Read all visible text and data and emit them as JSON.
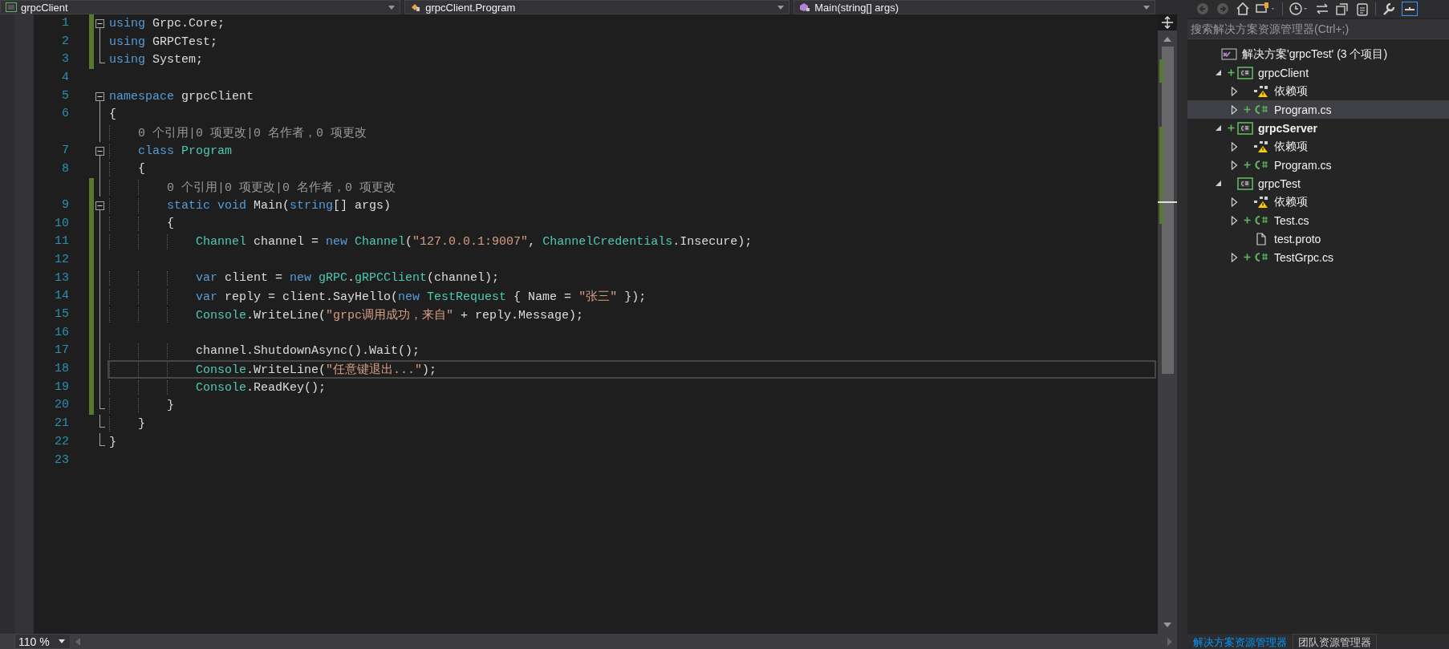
{
  "nav_bar": [
    {
      "kind": "project",
      "label": "grpcClient"
    },
    {
      "kind": "class",
      "label": "grpcClient.Program"
    },
    {
      "kind": "method",
      "label": "Main(string[] args)"
    }
  ],
  "editor": {
    "lines": [
      {
        "kind": "code",
        "number": "1",
        "changed": true,
        "collapsible": true,
        "region_end": false,
        "current": false,
        "tokens": [
          {
            "kind": "keyword",
            "text": "using"
          },
          {
            "kind": "plain",
            "text": " Grpc.Core;"
          }
        ]
      },
      {
        "kind": "code",
        "number": "2",
        "changed": true,
        "collapsible": false,
        "region_end": false,
        "current": false,
        "tokens": [
          {
            "kind": "keyword",
            "text": "using"
          },
          {
            "kind": "plain",
            "text": " GRPCTest;"
          }
        ]
      },
      {
        "kind": "code",
        "number": "3",
        "changed": true,
        "collapsible": false,
        "region_end": true,
        "current": false,
        "tokens": [
          {
            "kind": "keyword",
            "text": "using"
          },
          {
            "kind": "plain",
            "text": " System;"
          }
        ]
      },
      {
        "kind": "code",
        "number": "4",
        "changed": false,
        "collapsible": false,
        "region_end": false,
        "current": false
      },
      {
        "kind": "code",
        "number": "5",
        "changed": false,
        "collapsible": true,
        "region_end": false,
        "current": false,
        "tokens": [
          {
            "kind": "keyword",
            "text": "namespace"
          },
          {
            "kind": "plain",
            "text": " grpcClient"
          }
        ]
      },
      {
        "kind": "code",
        "number": "6",
        "changed": false,
        "collapsible": false,
        "region_end": false,
        "current": false,
        "tokens": [
          {
            "kind": "plain",
            "text": "{"
          }
        ]
      },
      {
        "kind": "lens",
        "changed": false,
        "current": false,
        "text": "0 个引用|0 项更改|0 名作者，0 项更改"
      },
      {
        "kind": "code",
        "number": "7",
        "changed": false,
        "collapsible": true,
        "region_end": false,
        "current": false,
        "tokens": [
          {
            "kind": "keyword",
            "text": "    class "
          },
          {
            "kind": "type",
            "text": "Program"
          }
        ]
      },
      {
        "kind": "code",
        "number": "8",
        "changed": false,
        "collapsible": false,
        "region_end": false,
        "current": false,
        "tokens": [
          {
            "kind": "plain",
            "text": "    {"
          }
        ]
      },
      {
        "kind": "lens",
        "changed": true,
        "current": false,
        "text": "0 个引用|0 项更改|0 名作者，0 项更改"
      },
      {
        "kind": "code",
        "number": "9",
        "changed": true,
        "collapsible": true,
        "region_end": false,
        "current": false,
        "tokens": [
          {
            "kind": "keyword",
            "text": "        static void"
          },
          {
            "kind": "plain",
            "text": " Main("
          },
          {
            "kind": "keyword",
            "text": "string"
          },
          {
            "kind": "plain",
            "text": "[] args)"
          }
        ]
      },
      {
        "kind": "code",
        "number": "10",
        "changed": true,
        "collapsible": false,
        "region_end": false,
        "current": false,
        "tokens": [
          {
            "kind": "plain",
            "text": "        {"
          }
        ]
      },
      {
        "kind": "code",
        "number": "11",
        "changed": true,
        "collapsible": false,
        "region_end": false,
        "current": false,
        "tokens": [
          {
            "kind": "type",
            "text": "            Channel"
          },
          {
            "kind": "plain",
            "text": " channel = "
          },
          {
            "kind": "keyword",
            "text": "new"
          },
          {
            "kind": "type",
            "text": " Channel"
          },
          {
            "kind": "plain",
            "text": "("
          },
          {
            "kind": "string",
            "text": "\"127.0.0.1:9007\""
          },
          {
            "kind": "plain",
            "text": ", "
          },
          {
            "kind": "type",
            "text": "ChannelCredentials"
          },
          {
            "kind": "plain",
            "text": ".Insecure);"
          }
        ]
      },
      {
        "kind": "code",
        "number": "12",
        "changed": true,
        "collapsible": false,
        "region_end": false,
        "current": false
      },
      {
        "kind": "code",
        "number": "13",
        "changed": true,
        "collapsible": false,
        "region_end": false,
        "current": false,
        "tokens": [
          {
            "kind": "keyword",
            "text": "            var"
          },
          {
            "kind": "plain",
            "text": " client = "
          },
          {
            "kind": "keyword",
            "text": "new"
          },
          {
            "kind": "type",
            "text": " gRPC"
          },
          {
            "kind": "plain",
            "text": "."
          },
          {
            "kind": "type",
            "text": "gRPCClient"
          },
          {
            "kind": "plain",
            "text": "(channel);"
          }
        ]
      },
      {
        "kind": "code",
        "number": "14",
        "changed": true,
        "collapsible": false,
        "region_end": false,
        "current": false,
        "tokens": [
          {
            "kind": "keyword",
            "text": "            var"
          },
          {
            "kind": "plain",
            "text": " reply = client.SayHello("
          },
          {
            "kind": "keyword",
            "text": "new"
          },
          {
            "kind": "type",
            "text": " TestRequest"
          },
          {
            "kind": "plain",
            "text": " { Name = "
          },
          {
            "kind": "string",
            "text": "\"张三\""
          },
          {
            "kind": "plain",
            "text": " });"
          }
        ]
      },
      {
        "kind": "code",
        "number": "15",
        "changed": true,
        "collapsible": false,
        "region_end": false,
        "current": false,
        "tokens": [
          {
            "kind": "type",
            "text": "            Console"
          },
          {
            "kind": "plain",
            "text": ".WriteLine("
          },
          {
            "kind": "string",
            "text": "\"grpc调用成功，来自\""
          },
          {
            "kind": "plain",
            "text": " + reply.Message);"
          }
        ]
      },
      {
        "kind": "code",
        "number": "16",
        "changed": true,
        "collapsible": false,
        "region_end": false,
        "current": false
      },
      {
        "kind": "code",
        "number": "17",
        "changed": true,
        "collapsible": false,
        "region_end": false,
        "current": false,
        "tokens": [
          {
            "kind": "plain",
            "text": "            channel.ShutdownAsync().Wait();"
          }
        ]
      },
      {
        "kind": "code",
        "number": "18",
        "changed": true,
        "collapsible": false,
        "region_end": false,
        "current": true,
        "tokens": [
          {
            "kind": "type",
            "text": "            Console"
          },
          {
            "kind": "plain",
            "text": ".WriteLine("
          },
          {
            "kind": "string",
            "text": "\"任意键退出...\""
          },
          {
            "kind": "plain",
            "text": ");"
          }
        ]
      },
      {
        "kind": "code",
        "number": "19",
        "changed": true,
        "collapsible": false,
        "region_end": false,
        "current": false,
        "tokens": [
          {
            "kind": "type",
            "text": "            Console"
          },
          {
            "kind": "plain",
            "text": ".ReadKey();"
          }
        ]
      },
      {
        "kind": "code",
        "number": "20",
        "changed": true,
        "collapsible": false,
        "region_end": true,
        "current": false,
        "tokens": [
          {
            "kind": "plain",
            "text": "        }"
          }
        ]
      },
      {
        "kind": "code",
        "number": "21",
        "changed": false,
        "collapsible": false,
        "region_end": true,
        "current": false,
        "tokens": [
          {
            "kind": "plain",
            "text": "    }"
          }
        ]
      },
      {
        "kind": "code",
        "number": "22",
        "changed": false,
        "collapsible": false,
        "region_end": true,
        "current": false,
        "tokens": [
          {
            "kind": "plain",
            "text": "}"
          }
        ]
      },
      {
        "kind": "code",
        "number": "23",
        "changed": false,
        "collapsible": false,
        "region_end": false,
        "current": false
      }
    ],
    "zoom": "110 %"
  },
  "solution_explorer": {
    "search": {
      "placeholder": "搜索解决方案资源管理器(Ctrl+;)"
    },
    "tree": [
      {
        "kind": "solution",
        "label": "解决方案'grpcTest' (3 个项目)",
        "selected": false,
        "startup": false,
        "pending_add": false,
        "children": [
          {
            "kind": "project",
            "label": "grpcClient",
            "expanded": true,
            "selected": false,
            "startup": false,
            "pending_add": true,
            "children": [
              {
                "kind": "dependencies",
                "label": "依赖项",
                "expanded": false,
                "selected": false,
                "startup": false,
                "pending_add": false
              },
              {
                "kind": "csfile",
                "label": "Program.cs",
                "expanded": false,
                "selected": true,
                "startup": false,
                "pending_add": true
              }
            ]
          },
          {
            "kind": "project",
            "label": "grpcServer",
            "expanded": true,
            "selected": false,
            "startup": true,
            "pending_add": true,
            "children": [
              {
                "kind": "dependencies",
                "label": "依赖项",
                "expanded": false,
                "selected": false,
                "startup": false,
                "pending_add": false
              },
              {
                "kind": "csfile",
                "label": "Program.cs",
                "expanded": false,
                "selected": false,
                "startup": false,
                "pending_add": true
              }
            ]
          },
          {
            "kind": "project",
            "label": "grpcTest",
            "expanded": true,
            "selected": false,
            "startup": false,
            "pending_add": false,
            "children": [
              {
                "kind": "dependencies",
                "label": "依赖项",
                "expanded": false,
                "selected": false,
                "startup": false,
                "pending_add": false
              },
              {
                "kind": "csfile",
                "label": "Test.cs",
                "expanded": false,
                "selected": false,
                "startup": false,
                "pending_add": true
              },
              {
                "kind": "file",
                "label": "test.proto",
                "selected": false,
                "startup": false,
                "pending_add": false
              },
              {
                "kind": "csfile",
                "label": "TestGrpc.cs",
                "expanded": false,
                "selected": false,
                "startup": false,
                "pending_add": true
              }
            ]
          }
        ]
      }
    ],
    "tabs": [
      {
        "label": "解决方案资源管理器",
        "selected": true
      },
      {
        "label": "团队资源管理器",
        "selected": false
      }
    ]
  }
}
